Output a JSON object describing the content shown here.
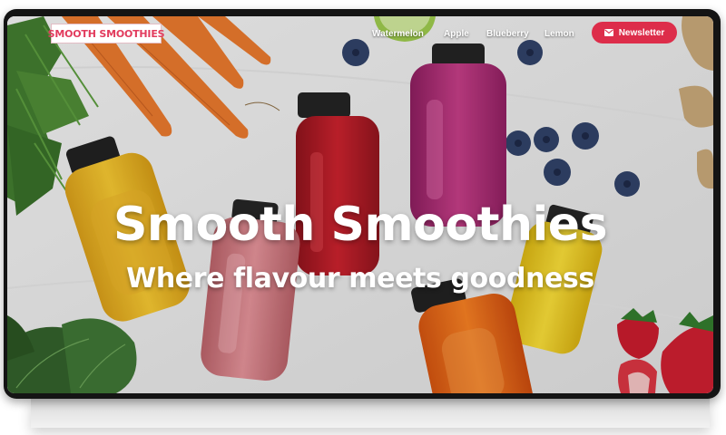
{
  "brand": {
    "logo_text": "SMOOTH SMOOTHIES",
    "accent": "#dd2d4a"
  },
  "nav": {
    "links": [
      {
        "label": "Watermelon"
      },
      {
        "label": "Apple"
      },
      {
        "label": "Blueberry"
      },
      {
        "label": "Lemon"
      }
    ],
    "newsletter_label": "Newsletter",
    "newsletter_icon": "envelope-icon"
  },
  "hero": {
    "title": "Smooth Smoothies",
    "subtitle": "Where flavour meets goodness"
  }
}
